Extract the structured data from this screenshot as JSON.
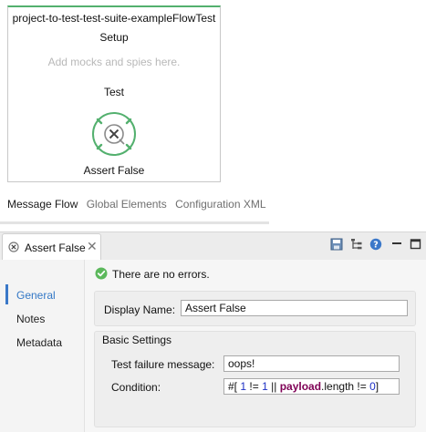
{
  "flow": {
    "name": "project-to-test-test-suite-exampleFlowTest",
    "sections": {
      "setup_label": "Setup",
      "setup_placeholder": "Add mocks and spies here.",
      "test_label": "Test"
    },
    "processor": {
      "label": "Assert False",
      "icon": "assert-icon",
      "ring_color": "#53b06e"
    }
  },
  "editor_tabs": [
    {
      "label": "Message Flow",
      "active": true
    },
    {
      "label": "Global Elements",
      "active": false
    },
    {
      "label": "Configuration XML",
      "active": false
    }
  ],
  "properties": {
    "tab_title": "Assert False",
    "toolbar_icons": [
      "save-icon",
      "tree-icon",
      "help-icon",
      "minimize-icon",
      "maximize-icon"
    ],
    "nav": [
      {
        "label": "General",
        "selected": true
      },
      {
        "label": "Notes",
        "selected": false
      },
      {
        "label": "Metadata",
        "selected": false
      }
    ],
    "status": "There are no errors.",
    "display_name_label": "Display Name:",
    "display_name_value": "Assert False",
    "basic_settings_title": "Basic Settings",
    "failure_message_label": "Test failure message:",
    "failure_message_value": "oops!",
    "condition_label": "Condition:",
    "condition_expression": {
      "open": "#[",
      "num1": "1",
      "op1": "!=",
      "num2": "1",
      "op2": "||",
      "keyword": "payload",
      "rest": ".length",
      "op3": "!=",
      "num3": "0",
      "close": "]"
    }
  },
  "colors": {
    "accent": "#3478c6",
    "ok_green": "#53b06e"
  }
}
